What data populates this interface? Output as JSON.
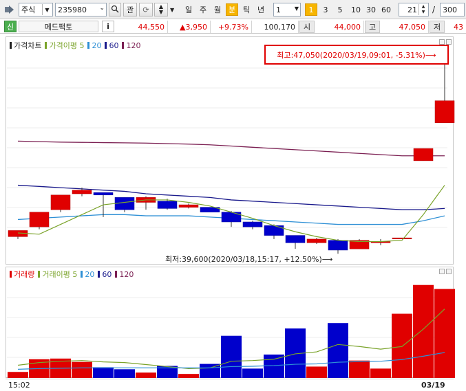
{
  "toolbar": {
    "market_select": "주식",
    "code_input": "235980",
    "info_btn": "관",
    "periods": [
      "일",
      "주",
      "월",
      "분",
      "틱",
      "년"
    ],
    "active_period": "분",
    "interval_value": "1",
    "intervals": [
      "1",
      "3",
      "5",
      "10",
      "30",
      "60"
    ],
    "active_interval": "1",
    "count_value": "21",
    "slash": "/",
    "total_value": "300"
  },
  "stockbar": {
    "badge": "신",
    "name": "메드팩토",
    "info_icon": "i",
    "price": "44,550",
    "change": "▲3,950",
    "change_pct": "+9.73%",
    "volume": "100,170",
    "open_label": "시",
    "open_value": "44,000",
    "high_label": "고",
    "high_value": "47,050",
    "low_label": "저",
    "low_value": "43"
  },
  "price_panel": {
    "legend_title": "가격차트",
    "legend_ma": "가격이평",
    "ma_periods": [
      "5",
      "20",
      "60",
      "120"
    ],
    "high_annotation": "최고:47,050(2020/03/19,09:01, -5.31%)⟶",
    "low_annotation": "최저:39,600(2020/03/18,15:17, +12.50%)⟶"
  },
  "volume_panel": {
    "legend_title": "거래량",
    "legend_ma": "거래이평",
    "ma_periods": [
      "5",
      "20",
      "60",
      "120"
    ]
  },
  "xaxis": {
    "left_label": "15:02",
    "right_label": "03/19"
  },
  "colors": {
    "up": "#e00000",
    "down": "#0000cc",
    "ma5": "#7aa32a",
    "ma20": "#2d8fd5",
    "ma60": "#1a1a8c",
    "ma120": "#7b1f52",
    "accent": "#f7b500"
  },
  "chart_data": {
    "type": "candlestick",
    "price_candles": [
      {
        "open": 39900,
        "close": 40150,
        "high": 40150,
        "low": 39800
      },
      {
        "open": 40300,
        "close": 40900,
        "high": 40900,
        "low": 40200
      },
      {
        "open": 41000,
        "close": 41600,
        "high": 41600,
        "low": 40900
      },
      {
        "open": 41650,
        "close": 41800,
        "high": 41900,
        "low": 41550
      },
      {
        "open": 41700,
        "close": 41600,
        "high": 41650,
        "low": 40700
      },
      {
        "open": 41500,
        "close": 41000,
        "high": 41500,
        "low": 40900
      },
      {
        "open": 41300,
        "close": 41500,
        "high": 41550,
        "low": 41000
      },
      {
        "open": 41350,
        "close": 41050,
        "high": 41450,
        "low": 41000
      },
      {
        "open": 41100,
        "close": 41200,
        "high": 41250,
        "low": 41050
      },
      {
        "open": 41100,
        "close": 40900,
        "high": 41100,
        "low": 40900
      },
      {
        "open": 40900,
        "close": 40500,
        "high": 40950,
        "low": 40300
      },
      {
        "open": 40500,
        "close": 40300,
        "high": 40550,
        "low": 40200
      },
      {
        "open": 40350,
        "close": 39950,
        "high": 40400,
        "low": 39800
      },
      {
        "open": 39950,
        "close": 39650,
        "high": 39950,
        "low": 39400
      },
      {
        "open": 39650,
        "close": 39800,
        "high": 39850,
        "low": 39600
      },
      {
        "open": 39750,
        "close": 39350,
        "high": 39800,
        "low": 39200
      },
      {
        "open": 39400,
        "close": 39750,
        "high": 39800,
        "low": 39400
      },
      {
        "open": 39650,
        "close": 39700,
        "high": 39800,
        "low": 39550
      },
      {
        "open": 39850,
        "close": 39850,
        "high": 39850,
        "low": 39850
      },
      {
        "open": 43000,
        "close": 43500,
        "high": 43500,
        "low": 43000
      },
      {
        "open": 44550,
        "close": 45450,
        "high": 47050,
        "low": 44550
      }
    ],
    "ma5": [
      40050,
      40000,
      40400,
      40800,
      41200,
      41300,
      41400,
      41400,
      41300,
      41150,
      40900,
      40650,
      40350,
      40100,
      39900,
      39750,
      39700,
      39700,
      39750,
      40800,
      42000
    ],
    "ma20": [
      40600,
      40650,
      40700,
      40750,
      40800,
      40800,
      40750,
      40750,
      40750,
      40700,
      40650,
      40600,
      40550,
      40500,
      40450,
      40400,
      40400,
      40400,
      40400,
      40550,
      40750
    ],
    "ma60": [
      42000,
      41950,
      41900,
      41850,
      41800,
      41750,
      41650,
      41600,
      41550,
      41500,
      41400,
      41350,
      41300,
      41250,
      41200,
      41150,
      41100,
      41050,
      41000,
      41000,
      41050
    ],
    "ma120": [
      43800,
      43780,
      43760,
      43750,
      43740,
      43730,
      43720,
      43700,
      43680,
      43650,
      43600,
      43550,
      43500,
      43450,
      43400,
      43350,
      43300,
      43250,
      43200,
      43200,
      43200
    ],
    "volumes": [
      900,
      2800,
      2900,
      2400,
      1600,
      1300,
      800,
      1800,
      600,
      2100,
      6300,
      1400,
      3500,
      7400,
      1700,
      8200,
      2600,
      1400,
      9600,
      13900,
      13300
    ],
    "vol_ma5": [
      1900,
      2300,
      2500,
      2600,
      2400,
      2300,
      2000,
      1700,
      1400,
      1500,
      2500,
      2600,
      2800,
      3600,
      3900,
      5000,
      4700,
      4300,
      4700,
      7300,
      10300
    ],
    "vol_ma20": [
      1300,
      1400,
      1450,
      1500,
      1500,
      1500,
      1500,
      1500,
      1500,
      1500,
      1700,
      1750,
      1850,
      2050,
      2100,
      2350,
      2450,
      2500,
      2750,
      3250,
      3800
    ]
  }
}
